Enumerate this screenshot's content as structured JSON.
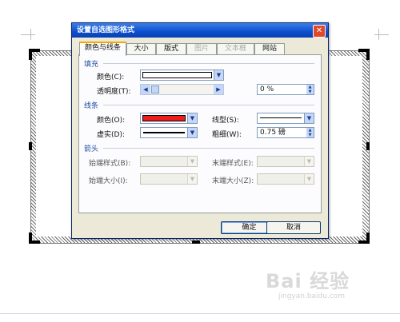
{
  "dialog": {
    "title": "设置自选图形格式",
    "close_glyph": "✕",
    "tabs": [
      {
        "label": "颜色与线条",
        "active": true
      },
      {
        "label": "大小"
      },
      {
        "label": "版式"
      },
      {
        "label": "图片",
        "disabled": true
      },
      {
        "label": "文本框",
        "disabled": true
      },
      {
        "label": "网站"
      }
    ]
  },
  "fill": {
    "group_label": "填充",
    "color_label": "颜色(C):",
    "color_value": "#ffffff",
    "transparency_label": "透明度(T):",
    "transparency_value": "0 %"
  },
  "line": {
    "group_label": "线条",
    "color_label": "颜色(O):",
    "color_value": "#ee1c1c",
    "style_label": "线型(S):",
    "dash_label": "虚实(D):",
    "weight_label": "粗细(W):",
    "weight_value": "0.75 磅"
  },
  "arrows": {
    "group_label": "箭头",
    "begin_style_label": "始端样式(B):",
    "end_style_label": "末端样式(E):",
    "begin_size_label": "始端大小(I):",
    "end_size_label": "末端大小(Z):"
  },
  "buttons": {
    "ok": "确定",
    "cancel": "取消"
  },
  "watermark": {
    "logo": "Bai 经验",
    "url": "jingyan.baidu.com"
  }
}
